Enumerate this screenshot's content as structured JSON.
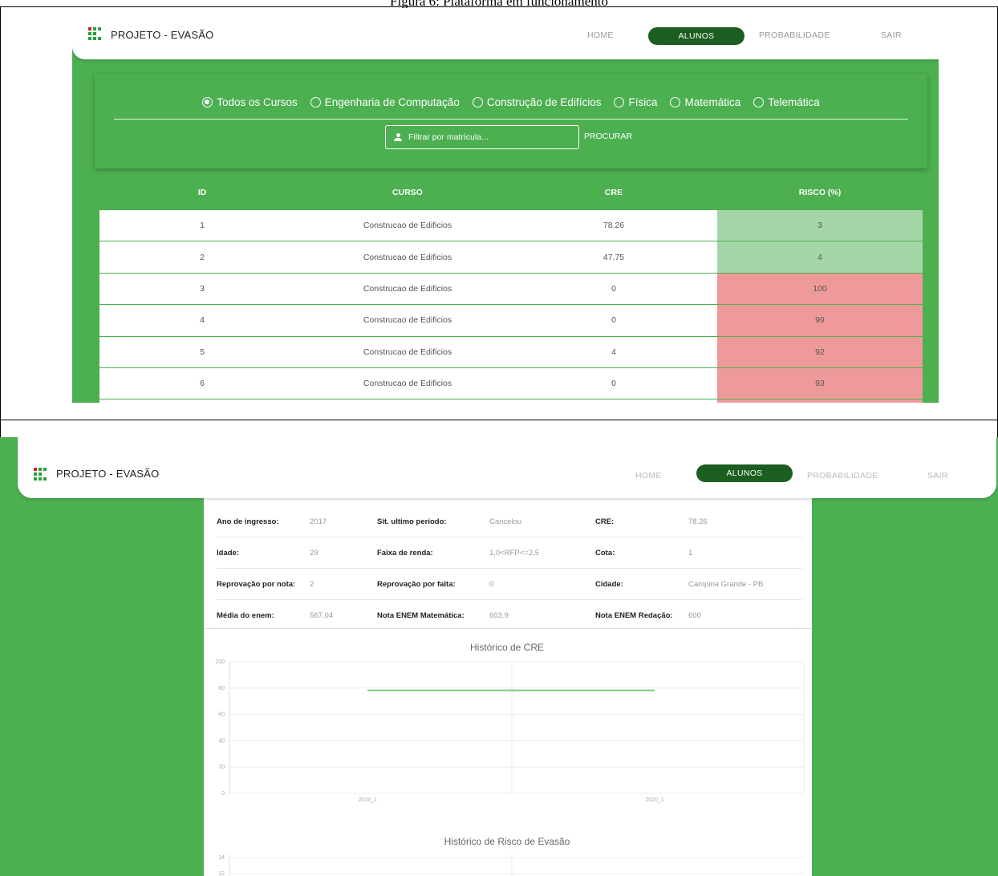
{
  "caption": "Figura 6: Plataforma em funcionamento",
  "colors": {
    "brand_green": "#4caf50",
    "dark_green": "#1b5e20",
    "risk_low": "#a5d6a7",
    "risk_high": "#ef9a9a",
    "line_green": "#81c784"
  },
  "nav": {
    "brand": "PROJETO - EVASÃO",
    "home": "HOME",
    "alunos": "ALUNOS",
    "probabilidade": "PROBABILIDADE",
    "sair": "SAIR"
  },
  "filters": {
    "options": [
      "Todos os Cursos",
      "Engenharia de Computação",
      "Construção de Edifícios",
      "Física",
      "Matemática",
      "Telemática"
    ],
    "selected": 0,
    "search_placeholder": "Filtrar por matrícula...",
    "search_button": "PROCURAR"
  },
  "table": {
    "headers": [
      "ID",
      "CURSO",
      "CRE",
      "RISCO (%)"
    ],
    "rows": [
      [
        "1",
        "Construcao de Edificios",
        "78.26",
        "3"
      ],
      [
        "2",
        "Construcao de Edificios",
        "47.75",
        "4"
      ],
      [
        "3",
        "Construcao de Edificios",
        "0",
        "100"
      ],
      [
        "4",
        "Construcao de Edificios",
        "0",
        "99"
      ],
      [
        "5",
        "Construcao de Edificios",
        "4",
        "92"
      ],
      [
        "6",
        "Construcao de Edificios",
        "0",
        "93"
      ]
    ]
  },
  "student": {
    "rows": [
      [
        [
          "Ano de ingresso:",
          "2017"
        ],
        [
          "Sit. ultimo período:",
          "Cancelou"
        ],
        [
          "CRE:",
          "78.26"
        ]
      ],
      [
        [
          "Idade:",
          "29"
        ],
        [
          "Faixa de renda:",
          "1,0<RFP<=2,5"
        ],
        [
          "Cota:",
          "1"
        ]
      ],
      [
        [
          "Reprovação por nota:",
          "2"
        ],
        [
          "Reprovação por falta:",
          "0"
        ],
        [
          "Cidade:",
          "Campina Grande - PB"
        ]
      ],
      [
        [
          "Média do enem:",
          "567.04"
        ],
        [
          "Nota ENEM Matemática:",
          "603.9"
        ],
        [
          "Nota ENEM Redação:",
          "600"
        ]
      ]
    ]
  },
  "chart_data": [
    {
      "type": "line",
      "title": "Histórico de CRE",
      "categories": [
        "2019_1",
        "2020_1"
      ],
      "series": [
        {
          "values": [
            78.26,
            78.26
          ]
        }
      ],
      "ylim": [
        0,
        100
      ],
      "yticks": [
        "100",
        "80",
        "60",
        "40",
        "20",
        "0"
      ],
      "grid": true
    },
    {
      "type": "line",
      "title": "Histórico de Risco de Evasão",
      "categories": [],
      "series": [],
      "yticks": [
        "14",
        "12"
      ],
      "grid": true
    }
  ]
}
